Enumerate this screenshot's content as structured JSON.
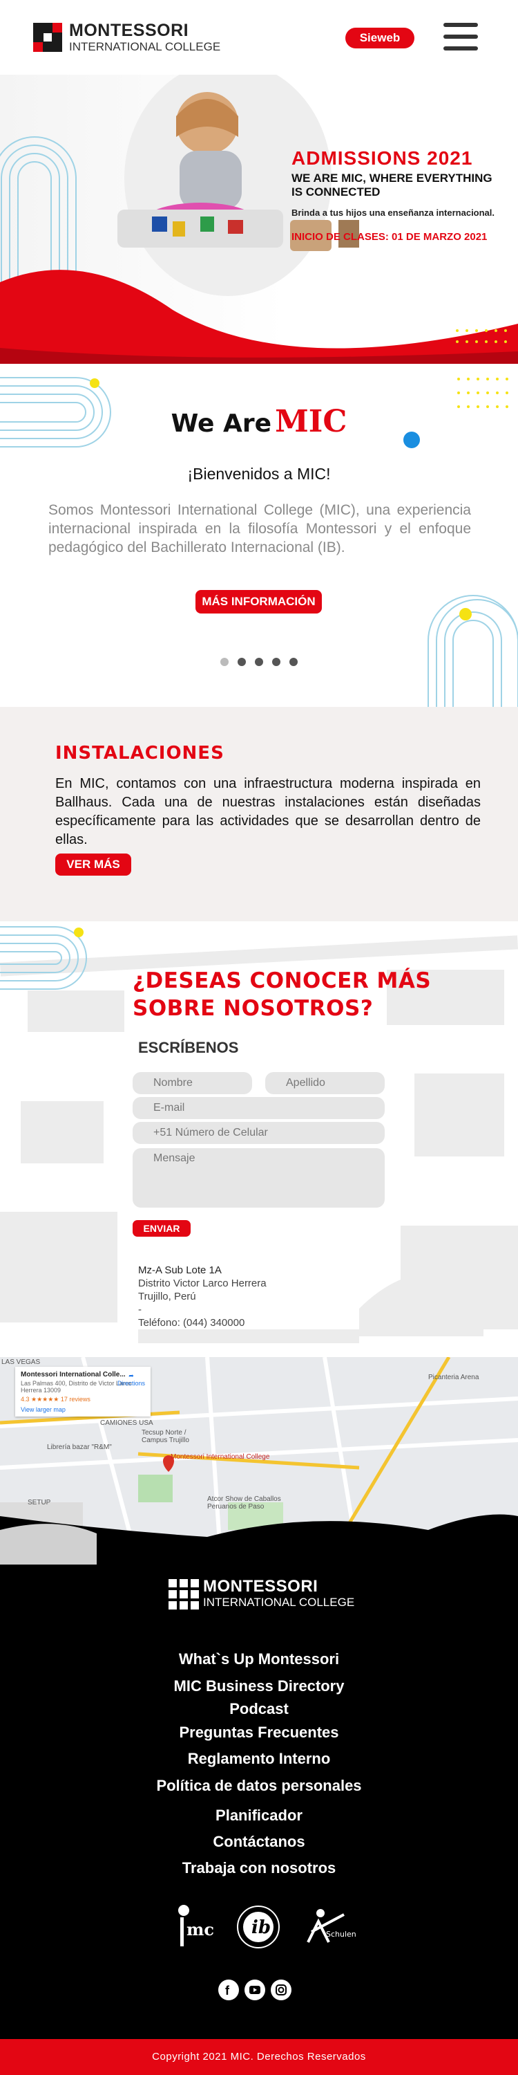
{
  "header": {
    "logo_line1": "MONTESSORI",
    "logo_line2": "INTERNATIONAL COLLEGE",
    "sieweb_label": "Sieweb",
    "menu_icon": "hamburger-icon"
  },
  "hero": {
    "title": "ADMISSIONS 2021",
    "subtitle": "WE ARE MIC, WHERE EVERYTHING IS CONNECTED",
    "tagline": "Brinda a tus hijos una enseñanza internacional.",
    "start_date": "INICIO DE CLASES: 01 DE MARZO 2021"
  },
  "about": {
    "title_part1": "We Are",
    "title_part2": "MIC",
    "welcome": "¡Bienvenidos a MIC!",
    "body": "Somos Montessori International College (MIC), una experiencia internacional inspirada en la filosofía Montessori y el enfoque pedagógico del Bachillerato Internacional (IB).",
    "button_label": "MÁS INFORMACIÓN",
    "slides_total": 5,
    "active_slide": 2
  },
  "facilities": {
    "title": "INSTALACIONES",
    "body": "En MIC, contamos con una infraestructura moderna inspirada en Ballhaus. Cada una de nuestras instalaciones están diseñadas específicamente para las actividades que se desarrollan dentro de ellas.",
    "button_label": "VER MÁS"
  },
  "contact": {
    "title": "¿DESEAS CONOCER MÁS SOBRE NOSOTROS?",
    "form_heading": "ESCRÍBENOS",
    "first_name_placeholder": "Nombre",
    "last_name_placeholder": "Apellido",
    "email_placeholder": "E-mail",
    "phone_placeholder": "+51 Número de Celular",
    "message_placeholder": "Mensaje",
    "submit_label": "ENVIAR",
    "address_line1": "Mz-A Sub Lote 1A",
    "address_line2": "Distrito Victor Larco Herrera",
    "address_line3": "Trujillo, Perú",
    "address_line4": "-",
    "phone": "Teléfono: (044) 340000"
  },
  "map": {
    "card_title": "Montessori International Colle...",
    "card_address": "Las Palmas 400, Distrito de Victor Larco Herrera 13009",
    "card_rating": "4.3 ★★★★★  17 reviews",
    "card_link": "View larger map",
    "directions_label": "Directions",
    "pin_label": "Montessori International College",
    "labels": [
      "LAS VEGAS",
      "Tecsup Norte / Campus Trujillo",
      "Atcor Show de Caballos Peruanos de Paso",
      "Librería bazar \"R&M\"",
      "Picanteria Arena",
      "CAMIONES USA",
      "SETUP"
    ]
  },
  "footer": {
    "logo_line1": "MONTESSORI",
    "logo_line2": "INTERNATIONAL COLLEGE",
    "nav": [
      "What`s Up Montessori",
      "MIC Business Directory",
      "Podcast",
      "Preguntas Frecuentes",
      "Reglamento Interno",
      "Política de datos personales",
      "Planificador",
      "Contáctanos",
      "Trabaja con nosotros"
    ],
    "partners": [
      "mic-partner-logo",
      "ib-world-school-logo",
      "schulen-partner-der-zukunft-logo"
    ],
    "partner_text": "Schulen: Partner der Zukunft",
    "socials": [
      "facebook-icon",
      "youtube-icon",
      "instagram-icon"
    ],
    "copyright": "Copyright   2021 MIC. Derechos Reservados"
  },
  "colors": {
    "brand_red": "#e30613",
    "footer_bg": "#000000",
    "accent_yellow": "#f5e214",
    "accent_blue": "#1a8ee0",
    "line_blue": "#9fd3e6"
  }
}
